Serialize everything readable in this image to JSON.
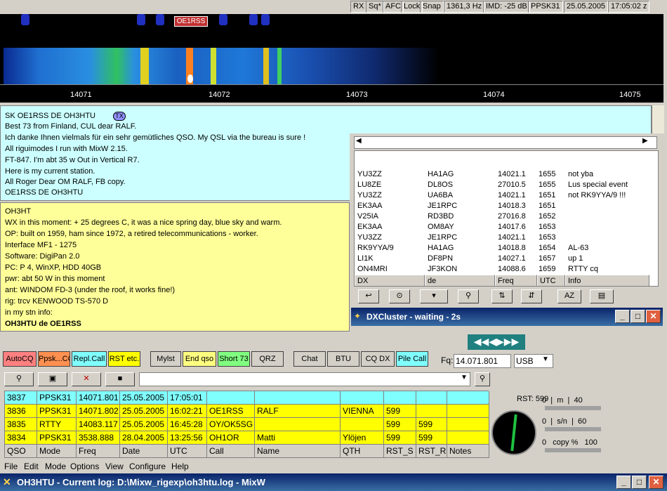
{
  "window": {
    "title": "OH3HTU - Current log: D:\\Mixw_rigexp\\oh3htu.log - MixW"
  },
  "menu": [
    "File",
    "Edit",
    "Mode",
    "Options",
    "View",
    "Configure",
    "Help"
  ],
  "status_bar": [
    "RX",
    "Sq*",
    "AFC",
    "Lock",
    "Snap",
    "1361,3 Hz",
    "IMD: -25 dB",
    "PPSK31",
    "25.05.2005",
    "17:05:02 z"
  ],
  "waterfall": {
    "callsign_tag": "OE1RSS",
    "freq_ticks": [
      "14071",
      "14072",
      "14073",
      "14074",
      "14075"
    ]
  },
  "tx_panel": {
    "lines": [
      "SK OE1RSS DE OH3HTU",
      "Best 73 from Finland, CUL dear RALF.",
      "Ich danke Ihnen vielmals für ein sehr gemütliches QSO. My QSL via the bureau is sure !",
      "All riguimodes I run with MixW 2.15.",
      "FT-847. I'm abt 35 w Out in Vertical R7.",
      "Here is my current station.",
      "All Roger Dear OM RALF, FB copy.",
      " OE1RSS DE OH3HTU"
    ],
    "tx_badge": "TX"
  },
  "info_panel": {
    "lines": [
      "OH3HT",
      "WX in this moment: + 25 degrees C, it was a nice spring day, blue sky and warm.",
      "OP: built on 1959, ham since 1972, a retired telecommunications - worker.",
      "            Interface MF1 - 1275",
      "Software: DigiPan       2.0",
      "PC: P 4, WinXP, HDD 40GB",
      "     pwr: abt 50 W in this moment",
      "     ant: WINDOM FD-3 (under the roof, it works fine!)",
      "rig: trcv KENWOOD TS-570 D",
      "in my stn info:",
      "OH3HTU de  OE1RSS"
    ]
  },
  "dx_cluster": {
    "title": "DXCluster - waiting - 2s",
    "columns": [
      "DX",
      "de",
      "Freq",
      "UTC",
      "Info"
    ],
    "rows": [
      [
        "ON4MRI",
        "JF3KON",
        "14088.6",
        "1659",
        "RTTY cq"
      ],
      [
        "LI1K",
        "DF8PN",
        "14027.1",
        "1657",
        "up 1"
      ],
      [
        "RK9YYA/9",
        "HA1AG",
        "14018.8",
        "1654",
        "AL-63"
      ],
      [
        "YU3ZZ",
        "JE1RPC",
        "14021.1",
        "1653",
        ""
      ],
      [
        "EK3AA",
        "OM8AY",
        "14017.6",
        "1653",
        ""
      ],
      [
        "V25IA",
        "RD3BD",
        "27016.8",
        "1652",
        ""
      ],
      [
        "EK3AA",
        "JE1RPC",
        "14018.3",
        "1651",
        ""
      ],
      [
        "YU3ZZ",
        "UA6BA",
        "14021.1",
        "1651",
        "not RK9YYA/9 !!!"
      ],
      [
        "LU8ZE",
        "DL8OS",
        "27010.5",
        "1655",
        "Lus special event"
      ],
      [
        "YU3ZZ",
        "HA1AG",
        "14021.1",
        "1655",
        "not yba"
      ]
    ]
  },
  "macros": [
    "AutoCQ",
    "Ppsk...CQ",
    "Repl.Call",
    "RST etc.",
    "Mylst",
    "End qso",
    "Short 73",
    "QRZ",
    "Chat",
    "BTU",
    "CQ DX",
    "Pile Call"
  ],
  "radio": {
    "freq_label": "Fq:",
    "freq": "14.071.801",
    "mode": "USB"
  },
  "log": {
    "columns": [
      "QSO",
      "Mode",
      "Freq",
      "Date",
      "UTC",
      "Call",
      "Name",
      "QTH",
      "RST_S",
      "RST_R",
      "Notes"
    ],
    "rows": [
      [
        "3834",
        "PPSK31",
        "3538.888",
        "28.04.2005",
        "13:25:56",
        "OH1OR",
        "Matti",
        "Ylöjen",
        "599",
        "599",
        ""
      ],
      [
        "3835",
        "RTTY",
        "14083.117",
        "25.05.2005",
        "16:45:28",
        "OY/OK5SG",
        "",
        "",
        "599",
        "599",
        ""
      ],
      [
        "3836",
        "PPSK31",
        "14071.802",
        "25.05.2005",
        "16:02:21",
        "OE1RSS",
        "RALF",
        "VIENNA",
        "599",
        "",
        ""
      ],
      [
        "3837",
        "PPSK31",
        "14071.801",
        "25.05.2005",
        "17:05:01",
        "",
        "",
        "",
        "",
        "",
        ""
      ]
    ]
  },
  "meters": {
    "rst_label": "RST: 599",
    "scale1": [
      "0",
      "|",
      "/",
      "|m",
      "|",
      "40"
    ],
    "scale2": [
      "0",
      "|",
      "s/n",
      "|",
      "60"
    ],
    "scale3": [
      "0",
      "copy %",
      "100"
    ]
  }
}
